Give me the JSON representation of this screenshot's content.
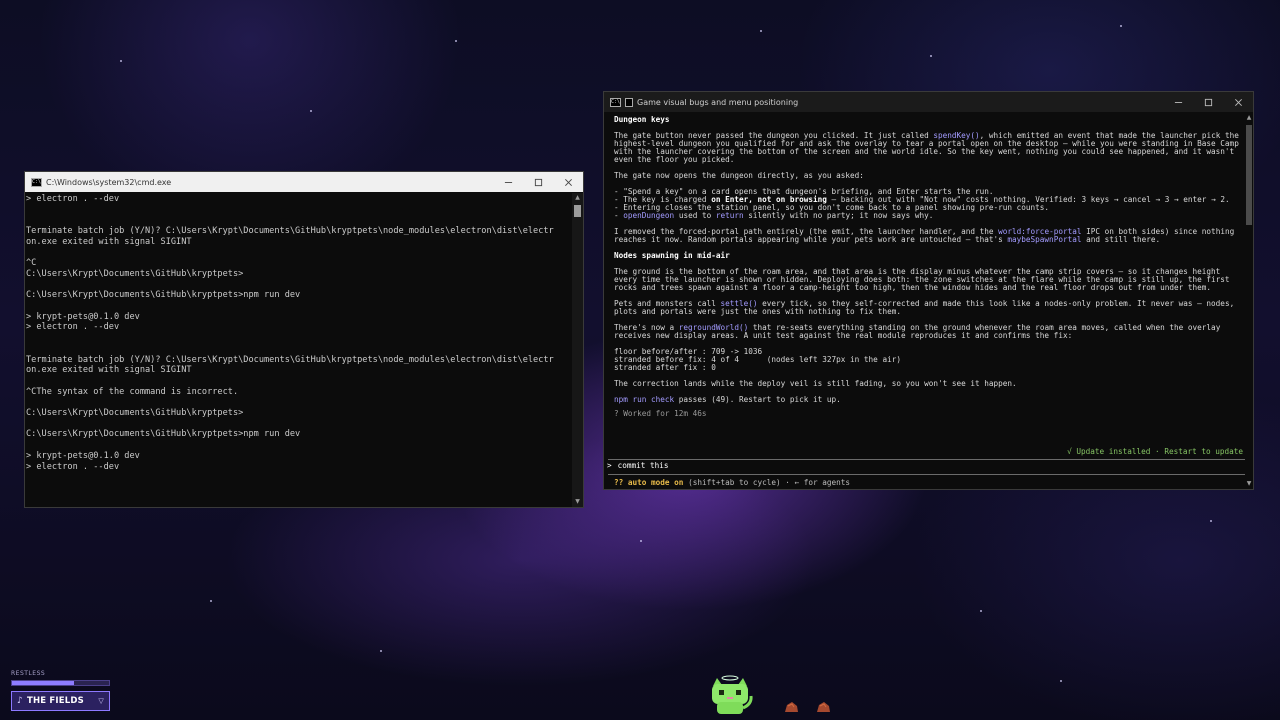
{
  "cmd_window": {
    "title": "C:\\Windows\\system32\\cmd.exe",
    "lines": [
      "> electron . --dev",
      "",
      "",
      "Terminate batch job (Y/N)? C:\\Users\\Krypt\\Documents\\GitHub\\kryptpets\\node_modules\\electron\\dist\\electr",
      "on.exe exited with signal SIGINT",
      "",
      "^C",
      "C:\\Users\\Krypt\\Documents\\GitHub\\kryptpets>",
      "",
      "C:\\Users\\Krypt\\Documents\\GitHub\\kryptpets>npm run dev",
      "",
      "> krypt-pets@0.1.0 dev",
      "> electron . --dev",
      "",
      "",
      "Terminate batch job (Y/N)? C:\\Users\\Krypt\\Documents\\GitHub\\kryptpets\\node_modules\\electron\\dist\\electr",
      "on.exe exited with signal SIGINT",
      "",
      "^CThe syntax of the command is incorrect.",
      "",
      "C:\\Users\\Krypt\\Documents\\GitHub\\kryptpets>",
      "",
      "C:\\Users\\Krypt\\Documents\\GitHub\\kryptpets>npm run dev",
      "",
      "> krypt-pets@0.1.0 dev",
      "> electron . --dev"
    ]
  },
  "agent_window": {
    "title": "Game visual bugs and menu positioning",
    "heading1": "Dungeon keys",
    "p1_a": "The gate button never passed the dungeon you clicked. It just called ",
    "p1_code": "spendKey()",
    "p1_b": ", which emitted an event that made the launcher pick the highest-level dungeon you qualified for and ask the overlay to tear a portal open on the desktop — while you were standing in Base Camp with the launcher covering the bottom of the screen and the world idle. So the key went, nothing you could see happened, and it wasn't even the floor you picked.",
    "p2": "The gate now opens the dungeon directly, as you asked:",
    "b1": "- \"Spend a key\" on a card opens that dungeon's briefing, and Enter starts the run.",
    "b2_a": "- The key is charged ",
    "b2_bold": "on Enter, not on browsing",
    "b2_b": " — backing out with \"Not now\" costs nothing. Verified: 3 keys → cancel → 3 → enter → 2.",
    "b3": "- Entering closes the station panel, so you don't come back to a panel showing pre-run counts.",
    "b4_a": "- ",
    "b4_code1": "openDungeon",
    "b4_b": " used to ",
    "b4_code2": "return",
    "b4_c": " silently with no party; it now says why.",
    "p3_a": "I removed the forced-portal path entirely (the emit, the launcher handler, and the ",
    "p3_code1": "world:force-portal",
    "p3_b": " IPC on both sides) since nothing reaches it now. Random portals appearing while your pets work are untouched — that's ",
    "p3_code2": "maybeSpawnPortal",
    "p3_c": " and still there.",
    "heading2": "Nodes spawning in mid-air",
    "p4": "The ground is the bottom of the roam area, and that area is the display minus whatever the camp strip covers — so it changes height every time the launcher is shown or hidden. Deploying does both: the zone switches at the flare while the camp is still up, the first rocks and trees spawn against a floor a camp-height too high, then the window hides and the real floor drops out from under them.",
    "p5_a": "Pets and monsters call ",
    "p5_code": "settle()",
    "p5_b": " every tick, so they self-corrected and made this look like a nodes-only problem. It never was — nodes, plots and portals were just the ones with nothing to fix them.",
    "p6_a": "There's now a ",
    "p6_code": "regroundWorld()",
    "p6_b": " that re-seats everything standing on the ground whenever the roam area moves, called when the overlay receives new display areas. A unit test against the real module reproduces it and confirms the fix:",
    "stats": "floor before/after : 709 -> 1036\nstranded before fix: 4 of 4      (nodes left 327px in the air)\nstranded after fix : 0",
    "p7": "The correction lands while the deploy veil is still fading, so you won't see it happen.",
    "p8_code": "npm run check",
    "p8_b": " passes (49). Restart to pick it up.",
    "worked": "? Worked for 12m 46s",
    "update": "√ Update installed · Restart to update",
    "prompt_chevron": ">",
    "prompt_text": "commit this",
    "mode_label": "?? auto mode on",
    "mode_hint": " (shift+tab to cycle) · ← for agents"
  },
  "hud": {
    "status": "RESTLESS",
    "status_level": 0.64,
    "zone_label": "THE FIELDS",
    "accent": "#8d78ff"
  },
  "icons": {
    "zone": "path-icon",
    "zone_chevron": "chevron-down-icon",
    "pet": "cat-pet-icon"
  }
}
